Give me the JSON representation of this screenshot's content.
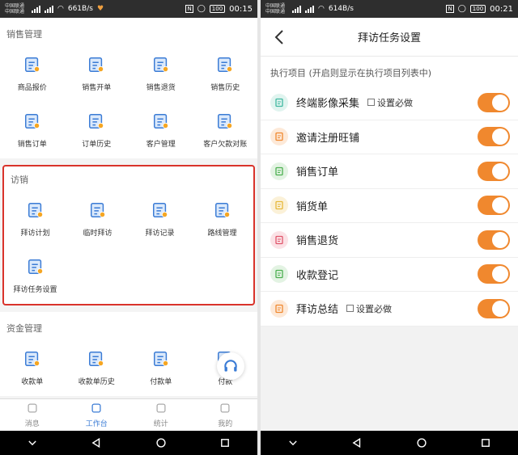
{
  "left_status": {
    "carrier_1": "中国联通",
    "carrier_2": "中国联通",
    "speed": "661B/s",
    "battery": "100",
    "time": "00:15"
  },
  "right_status": {
    "carrier_1": "中国联通",
    "carrier_2": "中国联通",
    "speed": "614B/s",
    "battery": "100",
    "time": "00:21"
  },
  "sales": {
    "title": "销售管理",
    "items": [
      {
        "label": "商品报价",
        "icon": "house-icon"
      },
      {
        "label": "销售开单",
        "icon": "yen-doc-icon"
      },
      {
        "label": "销售退货",
        "icon": "return-doc-icon"
      },
      {
        "label": "销售历史",
        "icon": "clock-doc-icon"
      },
      {
        "label": "销售订单",
        "icon": "list-doc-icon"
      },
      {
        "label": "订单历史",
        "icon": "calendar-clock-icon"
      },
      {
        "label": "客户管理",
        "icon": "person-doc-icon"
      },
      {
        "label": "客户欠款对账",
        "icon": "money-doc-icon"
      }
    ]
  },
  "visit": {
    "title": "访销",
    "items": [
      {
        "label": "拜访计划",
        "icon": "plan-icon"
      },
      {
        "label": "临时拜访",
        "icon": "calendar-icon"
      },
      {
        "label": "拜访记录",
        "icon": "record-icon"
      },
      {
        "label": "路线管理",
        "icon": "route-icon"
      },
      {
        "label": "拜访任务设置",
        "icon": "settings-doc-icon"
      }
    ]
  },
  "funds": {
    "title": "资金管理",
    "items": [
      {
        "label": "收款单",
        "icon": "receipt-icon"
      },
      {
        "label": "收款单历史",
        "icon": "receipt-history-icon"
      },
      {
        "label": "付款单",
        "icon": "payment-icon"
      },
      {
        "label": "付款",
        "icon": "payment-history-icon"
      }
    ]
  },
  "bottom_nav": [
    {
      "label": "消息",
      "icon": "message-icon"
    },
    {
      "label": "工作台",
      "icon": "workbench-icon"
    },
    {
      "label": "统计",
      "icon": "stats-icon"
    },
    {
      "label": "我的",
      "icon": "profile-icon"
    }
  ],
  "task_settings": {
    "title": "拜访任务设置",
    "subhead": "执行项目 (开启则显示在执行项目列表中)",
    "rows": [
      {
        "label": "终端影像采集",
        "check_label": "设置必做",
        "enabled": true,
        "color": "#3fb8a0",
        "tint": "#e0f4ef"
      },
      {
        "label": "邀请注册旺铺",
        "enabled": true,
        "color": "#f0882e",
        "tint": "#fde9d8"
      },
      {
        "label": "销售订单",
        "enabled": true,
        "color": "#4cb050",
        "tint": "#e3f3e3"
      },
      {
        "label": "销货单",
        "enabled": true,
        "color": "#e6b83a",
        "tint": "#fbf1d8"
      },
      {
        "label": "销售退货",
        "enabled": true,
        "color": "#e0566c",
        "tint": "#fbe2e6"
      },
      {
        "label": "收款登记",
        "enabled": true,
        "color": "#4cb050",
        "tint": "#e3f3e3"
      },
      {
        "label": "拜访总结",
        "check_label": "设置必做",
        "enabled": true,
        "color": "#f0882e",
        "tint": "#fde9d8"
      }
    ]
  },
  "colors": {
    "accent": "#3a7bd5",
    "toggle_on": "#f0882e",
    "highlight_border": "#d9332b"
  }
}
